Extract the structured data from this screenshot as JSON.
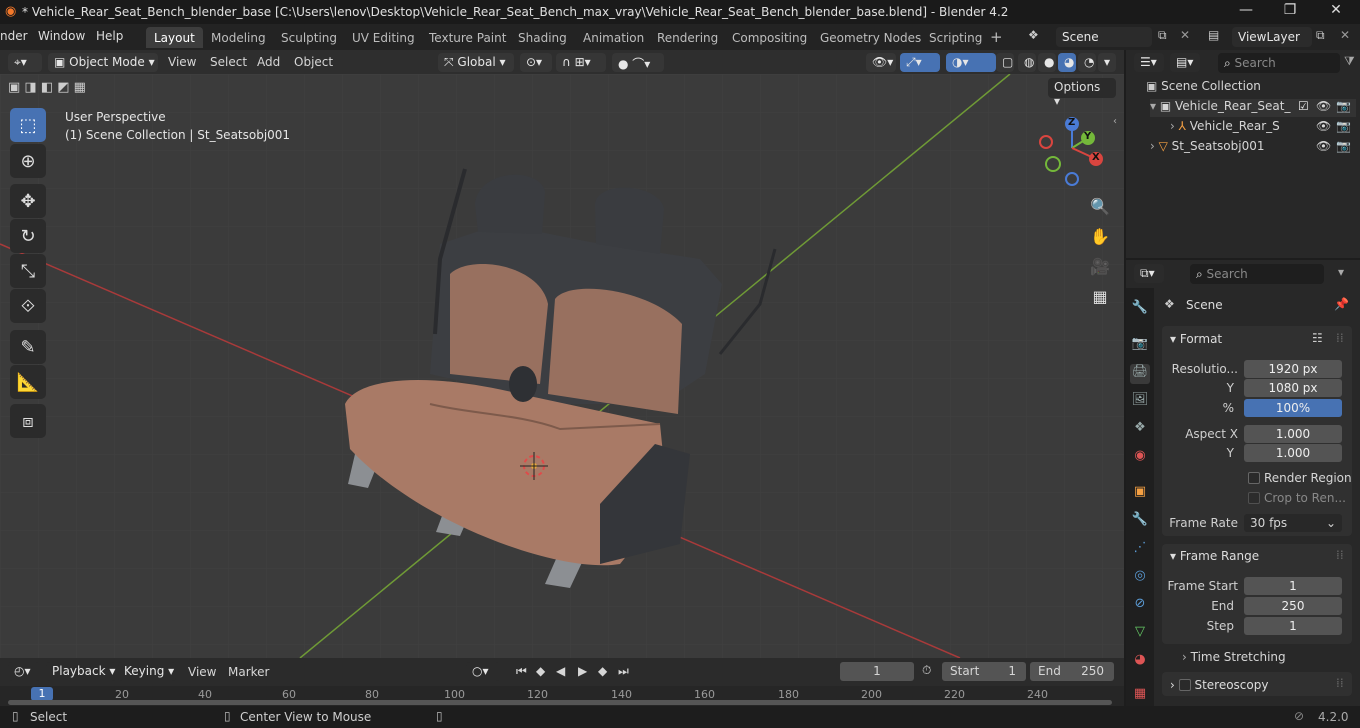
{
  "window": {
    "title": "* Vehicle_Rear_Seat_Bench_blender_base [C:\\Users\\lenov\\Desktop\\Vehicle_Rear_Seat_Bench_max_vray\\Vehicle_Rear_Seat_Bench_blender_base.blend] - Blender 4.2"
  },
  "menu": {
    "render": "nder",
    "window": "Window",
    "help": "Help"
  },
  "workspaces": [
    "Layout",
    "Modeling",
    "Sculpting",
    "UV Editing",
    "Texture Paint",
    "Shading",
    "Animation",
    "Rendering",
    "Compositing",
    "Geometry Nodes",
    "Scripting"
  ],
  "scene": {
    "name": "Scene",
    "view_layer": "ViewLayer"
  },
  "header3d": {
    "mode": "Object Mode",
    "view": "View",
    "select": "Select",
    "add": "Add",
    "object": "Object",
    "orientation": "Global",
    "options": "Options"
  },
  "viewport": {
    "perspective": "User Perspective",
    "collection_info": "(1) Scene Collection | St_Seatsobj001",
    "gizmo": {
      "x": "X",
      "y": "Y",
      "z": "Z"
    }
  },
  "outliner": {
    "search_placeholder": "Search",
    "root": "Scene Collection",
    "items": [
      "Vehicle_Rear_Seat_",
      "Vehicle_Rear_S",
      "St_Seatsobj001"
    ]
  },
  "properties": {
    "search_placeholder": "Search",
    "context": "Scene",
    "format": {
      "title": "Format",
      "resolution_label": "Resolutio...",
      "res_x": "1920 px",
      "y_label": "Y",
      "res_y": "1080 px",
      "pct_label": "%",
      "percent": "100%",
      "aspect_label": "Aspect X",
      "aspect_x": "1.000",
      "aspect_y": "1.000",
      "render_region": "Render Region",
      "crop": "Crop to Ren...",
      "frame_rate_label": "Frame Rate",
      "frame_rate": "30 fps"
    },
    "frame_range": {
      "title": "Frame Range",
      "start_label": "Frame Start",
      "start": "1",
      "end_label": "End",
      "end": "250",
      "step_label": "Step",
      "step": "1"
    },
    "time_stretching": "Time Stretching",
    "stereoscopy": "Stereoscopy"
  },
  "timeline": {
    "playback": "Playback",
    "keying": "Keying",
    "view": "View",
    "marker": "Marker",
    "current_frame": "1",
    "start_label": "Start",
    "start": "1",
    "end_label": "End",
    "end": "250",
    "ruler": [
      "1",
      "20",
      "40",
      "60",
      "80",
      "100",
      "120",
      "140",
      "160",
      "180",
      "200",
      "220",
      "240"
    ]
  },
  "status": {
    "select": "Select",
    "center": "Center View to Mouse",
    "version": "4.2.0"
  }
}
